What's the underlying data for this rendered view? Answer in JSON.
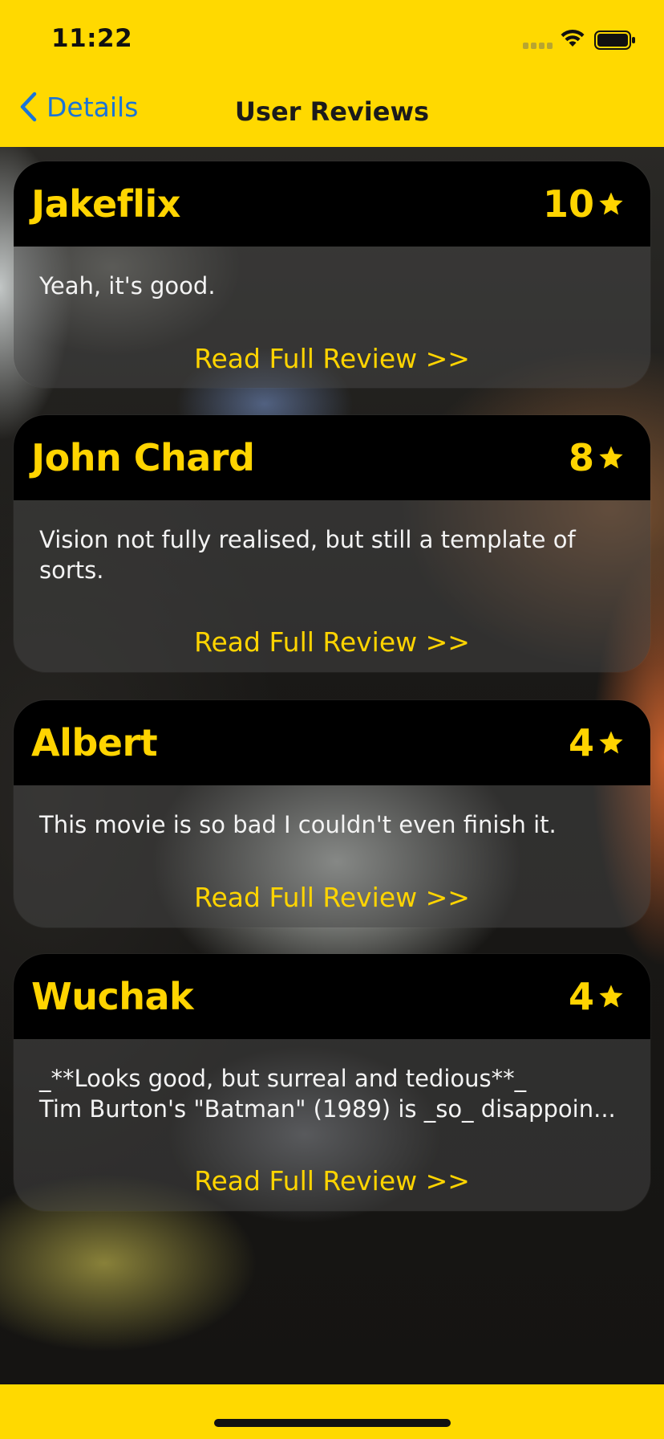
{
  "status_bar": {
    "time": "11:22"
  },
  "nav": {
    "back_label": "Details",
    "title": "User Reviews"
  },
  "reviews": [
    {
      "author": "Jakeflix",
      "rating": "10",
      "text": "Yeah, it's good.",
      "link": "Read Full Review >>"
    },
    {
      "author": "John Chard",
      "rating": "8",
      "text": "Vision not fully realised, but still a template of sorts.",
      "link": "Read Full Review >>"
    },
    {
      "author": "Albert",
      "rating": "4",
      "text": "This movie is so bad I couldn't even finish it.",
      "link": "Read Full Review >>"
    },
    {
      "author": "Wuchak",
      "rating": "4",
      "text": "_**Looks good, but surreal and tedious**_\nTim Burton's \"Batman\" (1989) is _so_ disappoin...",
      "link": "Read Full Review >>"
    }
  ],
  "colors": {
    "accent": "#ffd900",
    "link": "#1a74d8",
    "card_header": "#000000"
  }
}
